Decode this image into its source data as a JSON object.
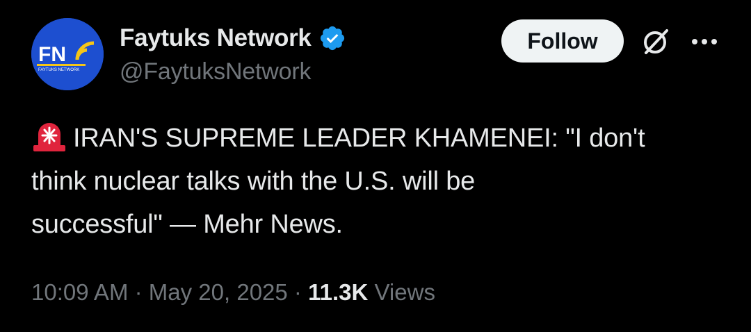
{
  "author": {
    "display_name": "Faytuks Network",
    "handle": "@FaytuksNetwork",
    "avatar_text": "FN",
    "avatar_subtext": "FAYTUKS NETWORK",
    "avatar_color": "#1d4fd0",
    "verified_badge_icon": "verified-badge-icon",
    "verified_color": "#1d9bf0"
  },
  "actions": {
    "follow_label": "Follow",
    "grok_icon": "grok-icon",
    "more_icon": "more-horizontal-icon"
  },
  "tweet": {
    "prefix_icon": "rotating-light-icon",
    "text_line1": "IRAN'S SUPREME LEADER KHAMENEI: \"I don't",
    "text_line2": "think nuclear talks with the U.S. will be",
    "text_line3": "successful\" — Mehr News."
  },
  "meta": {
    "time": "10:09 AM",
    "separator": "·",
    "date": "May 20, 2025",
    "views_count": "11.3K",
    "views_label": "Views"
  },
  "colors": {
    "background": "#000000",
    "primary_text": "#e7e9ea",
    "secondary_text": "#71767b",
    "follow_bg": "#eff3f4"
  }
}
